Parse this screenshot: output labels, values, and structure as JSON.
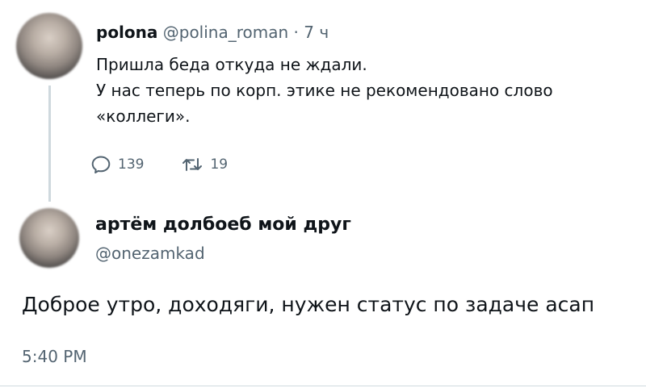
{
  "tweet1": {
    "author_name": "polona",
    "author_handle": "@polina_roman",
    "separator": "·",
    "time_ago": "7 ч",
    "lines": [
      "Пришла беда откуда не ждали.",
      "У нас теперь по корп. этике не рекомендовано слово",
      "«коллеги»."
    ],
    "reply_count": "139",
    "repost_count": "19",
    "reply_icon": "speech-bubble-icon",
    "repost_icon": "repost-arrows-icon"
  },
  "tweet2": {
    "author_name": "артём долбоеб мой друг",
    "author_handle": "@onezamkad",
    "text": "Доброе утро, доходяги, нужен статус по задаче асап",
    "timestamp": "5:40 PM"
  },
  "colors": {
    "text_primary": "#0f1419",
    "text_secondary": "#536471",
    "thread_line": "#cfd9de"
  }
}
